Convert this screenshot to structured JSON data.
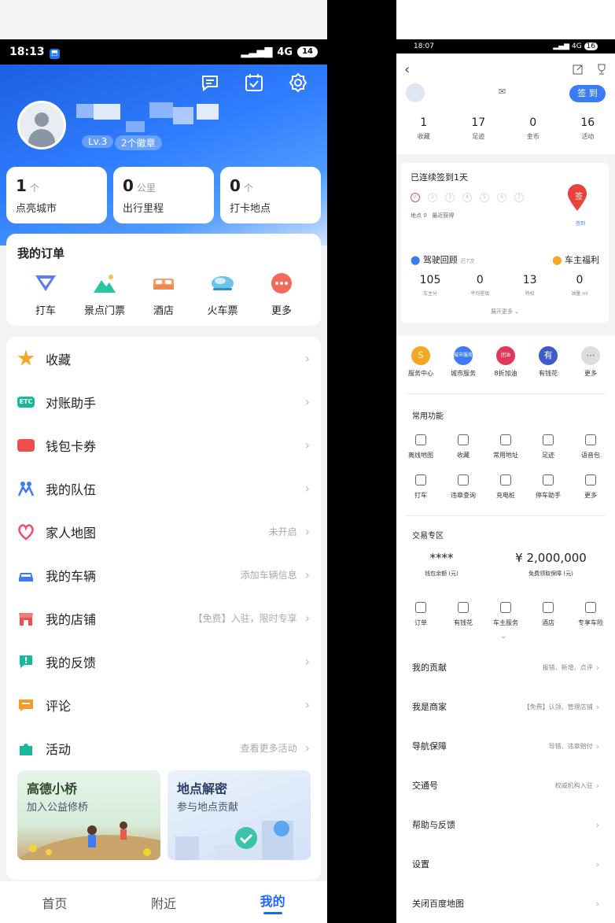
{
  "left": {
    "status": {
      "time": "18:13",
      "net": "4G",
      "battery": "14"
    },
    "profile": {
      "level": "Lv.3",
      "badges": "2个徽章"
    },
    "stats": [
      {
        "num": "1",
        "unit": "个",
        "label": "点亮城市"
      },
      {
        "num": "0",
        "unit": "公里",
        "label": "出行里程"
      },
      {
        "num": "0",
        "unit": "个",
        "label": "打卡地点"
      }
    ],
    "orders": {
      "title": "我的订单",
      "items": [
        {
          "label": "打车",
          "icon": "taxi-icon"
        },
        {
          "label": "景点门票",
          "icon": "mountain-icon"
        },
        {
          "label": "酒店",
          "icon": "bed-icon"
        },
        {
          "label": "火车票",
          "icon": "train-icon"
        },
        {
          "label": "更多",
          "icon": "more-icon"
        }
      ]
    },
    "menu": [
      {
        "label": "收藏",
        "hint": "",
        "color": "#f5a623",
        "icon": "star-icon"
      },
      {
        "label": "对账助手",
        "hint": "",
        "color": "#16b99a",
        "icon": "etc-icon"
      },
      {
        "label": "钱包卡券",
        "hint": "",
        "color": "#f04e4e",
        "icon": "ticket-icon"
      },
      {
        "label": "我的队伍",
        "hint": "",
        "color": "#3d7bf5",
        "icon": "team-icon"
      },
      {
        "label": "家人地图",
        "hint": "未开启",
        "color": "#f04e6a",
        "icon": "family-icon"
      },
      {
        "label": "我的车辆",
        "hint": "添加车辆信息",
        "color": "#3d7bf5",
        "icon": "car-icon"
      },
      {
        "label": "我的店铺",
        "hint": "【免费】入驻，限时专享",
        "color": "#f04e4e",
        "icon": "shop-icon"
      },
      {
        "label": "我的反馈",
        "hint": "",
        "color": "#16b99a",
        "icon": "feedback-icon"
      },
      {
        "label": "评论",
        "hint": "",
        "color": "#f59a23",
        "icon": "comment-icon"
      },
      {
        "label": "活动",
        "hint": "查看更多活动",
        "color": "#16b99a",
        "icon": "puzzle-icon"
      }
    ],
    "promos": [
      {
        "title": "高德小桥",
        "sub": "加入公益修桥"
      },
      {
        "title": "地点解密",
        "sub": "参与地点贡献"
      }
    ],
    "bottom_nav": [
      "首页",
      "附近",
      "我的"
    ]
  },
  "right": {
    "status": {
      "time": "18:07",
      "net": "4G",
      "battery": "16"
    },
    "sign_btn": "签 到",
    "stats": [
      {
        "num": "1",
        "label": "收藏"
      },
      {
        "num": "17",
        "label": "足迹"
      },
      {
        "num": "0",
        "label": "金币"
      },
      {
        "num": "16",
        "label": "活动"
      }
    ],
    "checkin": {
      "title": "已连续签到1天",
      "days": [
        "✓",
        "2",
        "3",
        "4",
        "5",
        "6",
        "7"
      ],
      "points": "地点  0",
      "recent": "最近获得",
      "pin_label": "签",
      "pin_sub": "签到"
    },
    "drive": {
      "title": "驾驶回顾",
      "sub": "近7次",
      "perk": "车主福利",
      "nums": [
        {
          "n": "105",
          "t": "车主分"
        },
        {
          "n": "0",
          "t": "平均星级"
        },
        {
          "n": "13",
          "t": "特权"
        },
        {
          "n": "0",
          "t": "油量 ml"
        }
      ],
      "expand": "展开更多"
    },
    "services": [
      {
        "label": "服务中心",
        "color": "#f5a623",
        "mark": "S"
      },
      {
        "label": "城市服务",
        "color": "#3d7bf5",
        "mark": "城市服务"
      },
      {
        "label": "8折加油",
        "color": "#e0385a",
        "mark": "团油"
      },
      {
        "label": "有钱花",
        "color": "#3d5cc8",
        "mark": "有"
      },
      {
        "label": "更多",
        "color": "#bbbbbb",
        "mark": "⋯"
      }
    ],
    "common_title": "常用功能",
    "common": [
      [
        "离线地图",
        "收藏",
        "常用地址",
        "足迹",
        "语音包"
      ],
      [
        "打车",
        "违章查询",
        "充电桩",
        "停车助手",
        "更多"
      ]
    ],
    "trade_title": "交易专区",
    "wallet": [
      {
        "n": "****",
        "t": "钱包余额 (元)"
      },
      {
        "n": "¥ 2,000,000",
        "t": "免费领取保障 (元)"
      }
    ],
    "trade": [
      "订单",
      "有钱花",
      "车主服务",
      "酒店",
      "专享车险"
    ],
    "list": [
      {
        "k": "我的贡献",
        "v": "报错、新增、点评"
      },
      {
        "k": "我是商家",
        "v": "【免费】认领、管理店铺"
      },
      {
        "k": "导航保障",
        "v": "导错、违章赔付"
      },
      {
        "k": "交通号",
        "v": "权威机构入驻"
      },
      {
        "k": "帮助与反馈",
        "v": ""
      },
      {
        "k": "设置",
        "v": ""
      },
      {
        "k": "关闭百度地图",
        "v": ""
      }
    ]
  }
}
